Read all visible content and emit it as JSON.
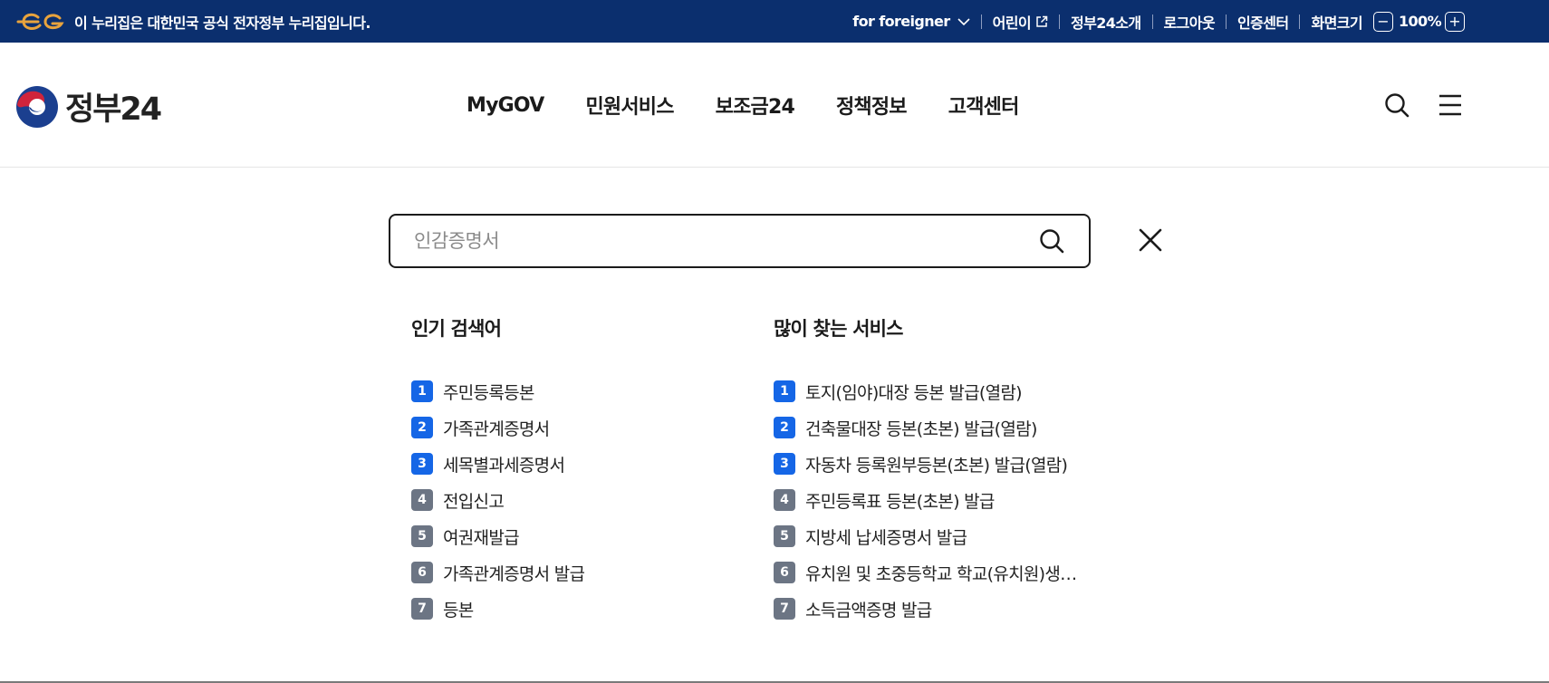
{
  "topbar": {
    "banner_text": "이 누리집은 대한민국 공식 전자정부 누리집입니다.",
    "links": [
      {
        "label": "for foreigner",
        "icon": "chevron-down-icon"
      },
      {
        "label": "어린이",
        "icon": "external-link-icon"
      },
      {
        "label": "정부24소개"
      },
      {
        "label": "로그아웃"
      },
      {
        "label": "인증센터"
      },
      {
        "label": "화면크기"
      }
    ],
    "zoom": {
      "minus": "−",
      "value": "100%",
      "plus": "+"
    }
  },
  "header": {
    "logo_text": "정부24",
    "nav": [
      "MyGOV",
      "민원서비스",
      "보조금24",
      "정책정보",
      "고객센터"
    ]
  },
  "search": {
    "placeholder": "인감증명서",
    "value": ""
  },
  "popular": {
    "title": "인기 검색어",
    "items": [
      {
        "rank": "1",
        "label": "주민등록등본"
      },
      {
        "rank": "2",
        "label": "가족관계증명서"
      },
      {
        "rank": "3",
        "label": "세목별과세증명서"
      },
      {
        "rank": "4",
        "label": "전입신고"
      },
      {
        "rank": "5",
        "label": "여권재발급"
      },
      {
        "rank": "6",
        "label": "가족관계증명서 발급"
      },
      {
        "rank": "7",
        "label": "등본"
      }
    ]
  },
  "services": {
    "title": "많이 찾는 서비스",
    "items": [
      {
        "rank": "1",
        "label": "토지(임야)대장 등본 발급(열람)"
      },
      {
        "rank": "2",
        "label": "건축물대장 등본(초본) 발급(열람)"
      },
      {
        "rank": "3",
        "label": "자동차 등록원부등본(초본) 발급(열람)"
      },
      {
        "rank": "4",
        "label": "주민등록표 등본(초본) 발급"
      },
      {
        "rank": "5",
        "label": "지방세 납세증명서 발급"
      },
      {
        "rank": "6",
        "label": "유치원 및 초중등학교 학교(유치원)생활기록부 발급"
      },
      {
        "rank": "7",
        "label": "소득금액증명 발급"
      }
    ]
  },
  "colors": {
    "topbar_bg": "#0b2f6e",
    "rank_top": "#1566e6",
    "rank_rest": "#6c7584",
    "logo_red": "#d0243b",
    "logo_blue": "#1b3f8f"
  }
}
